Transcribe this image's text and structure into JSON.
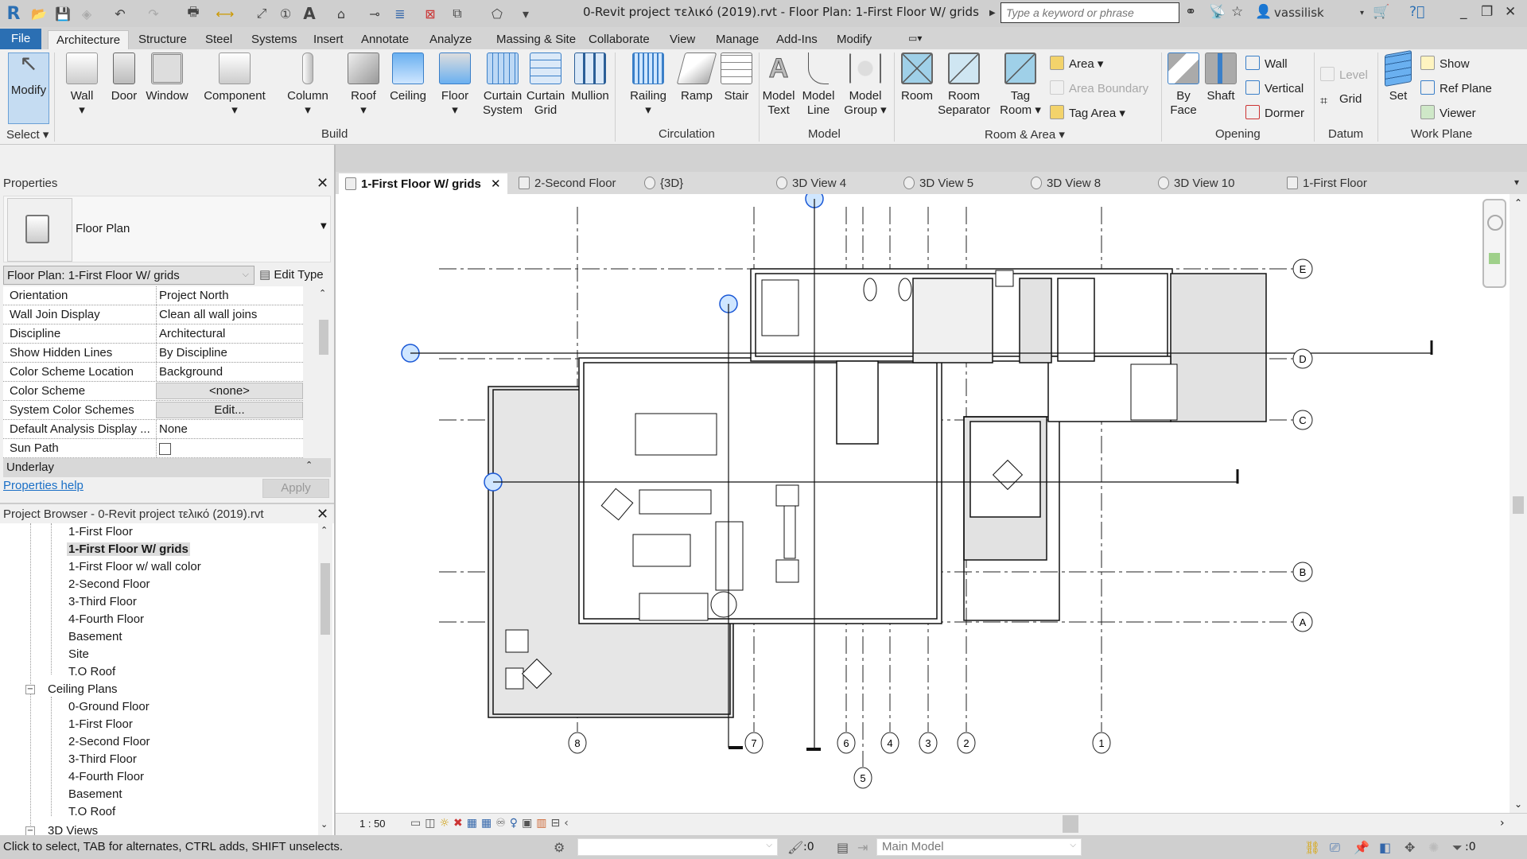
{
  "titlebar": {
    "app_logo": "R",
    "title": "0-Revit project τελικό (2019).rvt - Floor Plan: 1-First Floor  W/ grids",
    "search_placeholder": "Type a keyword or phrase",
    "user": "vassilisk",
    "quick_access_icons": [
      "open-icon",
      "save-icon",
      "sync-icon",
      "undo-icon",
      "redo-icon",
      "print-icon",
      "measure-icon",
      "aligned-dimension-icon",
      "tag-icon",
      "text-icon",
      "3d-view-icon",
      "section-icon",
      "thin-lines-icon",
      "close-hidden-icon",
      "switch-windows-icon",
      "customize-icon"
    ]
  },
  "ribbon_tabs": [
    "File",
    "Architecture",
    "Structure",
    "Steel",
    "Systems",
    "Insert",
    "Annotate",
    "Analyze",
    "Massing & Site",
    "Collaborate",
    "View",
    "Manage",
    "Add-Ins",
    "Modify"
  ],
  "active_ribbon_tab": "Architecture",
  "ribbon": {
    "select": {
      "modify": "Modify",
      "label": "Select"
    },
    "build": {
      "label": "Build",
      "buttons": [
        "Wall",
        "Door",
        "Window",
        "Component",
        "Column",
        "Roof",
        "Ceiling",
        "Floor",
        "Curtain System",
        "Curtain Grid",
        "Mullion"
      ]
    },
    "circulation": {
      "label": "Circulation",
      "buttons": [
        "Railing",
        "Ramp",
        "Stair"
      ]
    },
    "model": {
      "label": "Model",
      "buttons": [
        "Model Text",
        "Model Line",
        "Model Group"
      ]
    },
    "room_area": {
      "label": "Room & Area",
      "buttons": [
        "Room",
        "Room Separator",
        "Tag Room"
      ],
      "small": [
        "Area",
        "Area  Boundary",
        "Tag  Area"
      ]
    },
    "opening": {
      "label": "Opening",
      "buttons": [
        "By Face",
        "Shaft"
      ],
      "small": [
        "Wall",
        "Vertical",
        "Dormer"
      ]
    },
    "datum": {
      "label": "Datum",
      "small": [
        "Level",
        "Grid"
      ]
    },
    "work_plane": {
      "label": "Work Plane",
      "buttons": [
        "Set"
      ],
      "small": [
        "Show",
        "Ref  Plane",
        "Viewer"
      ]
    }
  },
  "properties": {
    "title": "Properties",
    "type_name": "Floor Plan",
    "instance_selector": "Floor Plan: 1-First Floor  W/ grids",
    "edit_type": "Edit Type",
    "rows": [
      {
        "key": "Orientation",
        "value": "Project North"
      },
      {
        "key": "Wall Join Display",
        "value": "Clean all wall joins"
      },
      {
        "key": "Discipline",
        "value": "Architectural"
      },
      {
        "key": "Show Hidden Lines",
        "value": "By Discipline"
      },
      {
        "key": "Color Scheme Location",
        "value": "Background"
      },
      {
        "key": "Color Scheme",
        "value": "<none>"
      },
      {
        "key": "System Color Schemes",
        "value": "Edit..."
      },
      {
        "key": "Default Analysis Display ...",
        "value": "None"
      },
      {
        "key": "Sun Path",
        "value": ""
      }
    ],
    "section": "Underlay",
    "help_link": "Properties help",
    "apply": "Apply"
  },
  "browser": {
    "title": "Project Browser - 0-Revit project τελικό (2019).rvt",
    "floor_plans": [
      "1-First Floor",
      "1-First Floor  W/ grids",
      "1-First Floor w/ wall color",
      "2-Second Floor",
      "3-Third Floor",
      "4-Fourth Floor",
      "Basement",
      "Site",
      "T.O Roof"
    ],
    "selected": "1-First Floor  W/ grids",
    "ceiling_plans_label": "Ceiling Plans",
    "ceiling_plans": [
      "0-Ground Floor",
      "1-First Floor",
      "2-Second Floor",
      "3-Third Floor",
      "4-Fourth Floor",
      "Basement",
      "T.O Roof"
    ],
    "views_3d_label": "3D Views"
  },
  "view_tabs": [
    {
      "label": "1-First Floor  W/ grids",
      "active": true
    },
    {
      "label": "2-Second Floor"
    },
    {
      "label": "{3D}"
    },
    {
      "label": "3D View 4"
    },
    {
      "label": "3D View 5"
    },
    {
      "label": "3D View 8"
    },
    {
      "label": "3D View 10"
    },
    {
      "label": "1-First Floor"
    }
  ],
  "drawing": {
    "grid_vertical": [
      "8",
      "7",
      "6",
      "5",
      "4",
      "3",
      "2",
      "1"
    ],
    "grid_horizontal": [
      "E",
      "D",
      "C",
      "B",
      "A"
    ]
  },
  "view_control_bar": {
    "scale": "1 : 50"
  },
  "status": {
    "message": "Click to select, TAB for alternates, CTRL adds, SHIFT unselects.",
    "editable_count": ":0",
    "model": "Main Model",
    "filter_count": ":0"
  }
}
